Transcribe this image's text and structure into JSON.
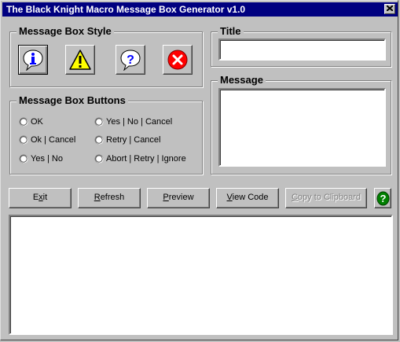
{
  "window": {
    "title": "The Black Knight Macro Message Box Generator v1.0"
  },
  "style_group": {
    "label": "Message Box Style",
    "buttons": [
      {
        "icon": "information-icon",
        "selected": true
      },
      {
        "icon": "exclamation-icon",
        "selected": false
      },
      {
        "icon": "question-icon",
        "selected": false
      },
      {
        "icon": "critical-icon",
        "selected": false
      }
    ]
  },
  "buttons_group": {
    "label": "Message Box Buttons",
    "options_left": [
      "OK",
      "Ok | Cancel",
      "Yes | No"
    ],
    "options_right": [
      "Yes | No | Cancel",
      "Retry | Cancel",
      "Abort | Retry | Ignore"
    ]
  },
  "title_group": {
    "label": "Title",
    "value": ""
  },
  "message_group": {
    "label": "Message",
    "value": ""
  },
  "commands": {
    "exit": {
      "pre": "E",
      "u": "x",
      "post": "it"
    },
    "refresh": {
      "pre": "",
      "u": "R",
      "post": "efresh"
    },
    "preview": {
      "pre": "",
      "u": "P",
      "post": "review"
    },
    "view_code": {
      "pre": "",
      "u": "V",
      "post": "iew Code"
    },
    "copy": {
      "pre": "",
      "u": "C",
      "post": "opy to Clipboard",
      "enabled": false
    }
  },
  "output": {
    "value": ""
  },
  "colors": {
    "titlebar": "#000080",
    "face": "#c0c0c0",
    "help": "#008000",
    "critical": "#ff0000",
    "warning": "#ffff00"
  }
}
